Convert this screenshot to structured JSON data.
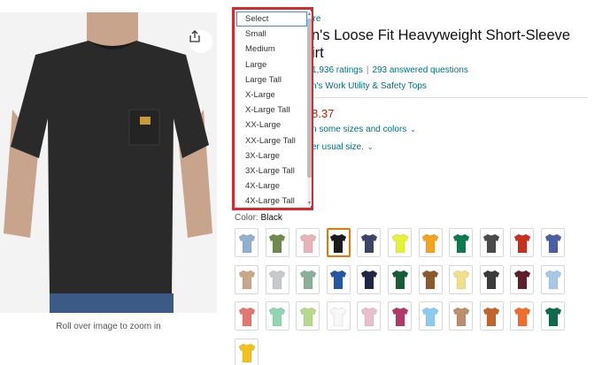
{
  "product": {
    "store_link": "ore",
    "title_line1": "n's Loose Fit Heavyweight Short-Sleeve",
    "title_line2": "irt",
    "ratings": "1,936 ratings",
    "questions": "293 answered questions",
    "category": "n's Work Utility & Safety Tops",
    "price": "8.37",
    "price_note": "n some sizes and colors",
    "fit_note": "er usual size."
  },
  "image": {
    "zoom_caption": "Roll over image to zoom in",
    "shirt_color": "#2a2a2a"
  },
  "color_selector": {
    "label": "Color:",
    "selected": "Black",
    "swatches": [
      {
        "name": "light-blue",
        "hex": "#8fb0cf"
      },
      {
        "name": "moss",
        "hex": "#6f8a4b"
      },
      {
        "name": "pink",
        "hex": "#e8b3b8"
      },
      {
        "name": "black",
        "hex": "#1c1c1c",
        "selected": true
      },
      {
        "name": "navy-heather",
        "hex": "#3d4566"
      },
      {
        "name": "hi-vis-yellow",
        "hex": "#e3f234"
      },
      {
        "name": "orange",
        "hex": "#f5a21d"
      },
      {
        "name": "green",
        "hex": "#0f7a4f"
      },
      {
        "name": "charcoal",
        "hex": "#4a4a4a"
      },
      {
        "name": "red",
        "hex": "#c7301f"
      },
      {
        "name": "blue",
        "hex": "#4c5fa3"
      },
      {
        "name": "tan",
        "hex": "#c9a88a"
      },
      {
        "name": "heather-gray",
        "hex": "#c9c9cc"
      },
      {
        "name": "sage",
        "hex": "#8bb09a"
      },
      {
        "name": "royal",
        "hex": "#2457a6"
      },
      {
        "name": "navy",
        "hex": "#1f2747"
      },
      {
        "name": "forest",
        "hex": "#155c37"
      },
      {
        "name": "brown",
        "hex": "#8a5a2b"
      },
      {
        "name": "pale-yellow",
        "hex": "#f0e08a"
      },
      {
        "name": "dark-charcoal",
        "hex": "#3b3b3b"
      },
      {
        "name": "maroon",
        "hex": "#5e1f2b"
      },
      {
        "name": "sky-blue",
        "hex": "#a8c7e8"
      },
      {
        "name": "coral",
        "hex": "#e2776f"
      },
      {
        "name": "mint",
        "hex": "#8fd6b3"
      },
      {
        "name": "light-green",
        "hex": "#b6d98d"
      },
      {
        "name": "white",
        "hex": "#f7f7f7"
      },
      {
        "name": "light-pink",
        "hex": "#e7bfcf"
      },
      {
        "name": "berry",
        "hex": "#b3386a"
      },
      {
        "name": "baby-blue",
        "hex": "#8ecbf0"
      },
      {
        "name": "khaki",
        "hex": "#b98f6c"
      },
      {
        "name": "rust",
        "hex": "#c2652a"
      },
      {
        "name": "bright-orange",
        "hex": "#f06d2b"
      },
      {
        "name": "teal-green",
        "hex": "#0e6b4a"
      },
      {
        "name": "gold",
        "hex": "#f3c21a"
      }
    ]
  },
  "size_dropdown": {
    "options": [
      "Select",
      "Small",
      "Medium",
      "Large",
      "Large Tall",
      "X-Large",
      "X-Large Tall",
      "XX-Large",
      "XX-Large Tall",
      "3X-Large",
      "3X-Large Tall",
      "4X-Large",
      "4X-Large Tall"
    ],
    "selected": "Select",
    "highlight_color": "#d9282f"
  }
}
